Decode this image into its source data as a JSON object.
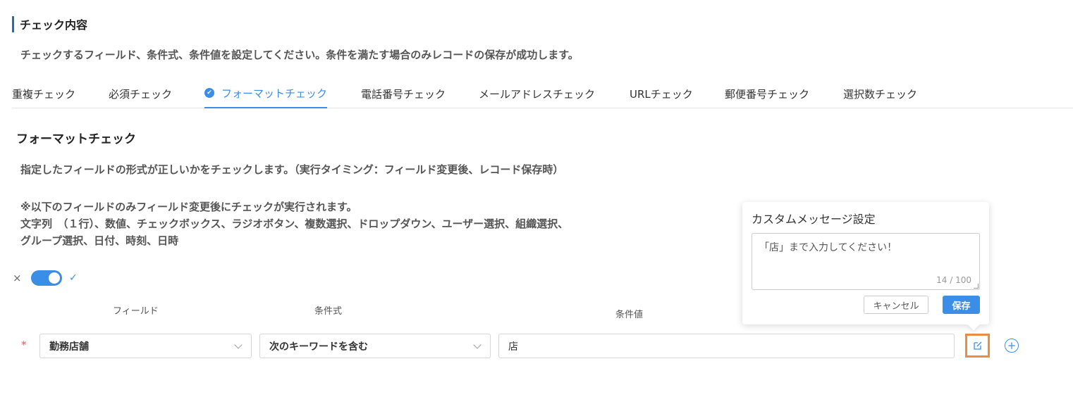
{
  "section": {
    "title": "チェック内容",
    "description": "チェックするフィールド、条件式、条件値を設定してください。条件を満たす場合のみレコードの保存が成功します。"
  },
  "tabs": [
    {
      "label": "重複チェック",
      "active": false
    },
    {
      "label": "必須チェック",
      "active": false
    },
    {
      "label": "フォーマットチェック",
      "active": true
    },
    {
      "label": "電話番号チェック",
      "active": false
    },
    {
      "label": "メールアドレスチェック",
      "active": false
    },
    {
      "label": "URLチェック",
      "active": false
    },
    {
      "label": "郵便番号チェック",
      "active": false
    },
    {
      "label": "選択数チェック",
      "active": false
    }
  ],
  "format_check": {
    "title": "フォーマットチェック",
    "description": "指定したフィールドの形式が正しいかをチェックします。（実行タイミング：フィールド変更後、レコード保存時）",
    "note_line1": "※以下のフィールドのみフィールド変更後にチェックが実行されます。",
    "note_line2": "文字列　（１行）、数値、チェックボックス、ラジオボタン、複数選択、ドロップダウン、ユーザー選択、組織選択、",
    "note_line3": "グループ選択、日付、時刻、日時"
  },
  "toggle": {
    "off_symbol": "×",
    "on_symbol": "✓",
    "enabled": true
  },
  "columns": {
    "field": "フィールド",
    "condition": "条件式",
    "value": "条件値"
  },
  "row": {
    "required_mark": "*",
    "field": "勤務店舗",
    "condition": "次のキーワードを含む",
    "value": "店"
  },
  "popover": {
    "title": "カスタムメッセージ設定",
    "message": "「店」まで入力してください！",
    "count": "14 / 100",
    "cancel_label": "キャンセル",
    "save_label": "保存"
  },
  "colors": {
    "accent": "#3b8ee8",
    "highlight": "#f08a3e",
    "title_bar": "#1f6fb2"
  }
}
